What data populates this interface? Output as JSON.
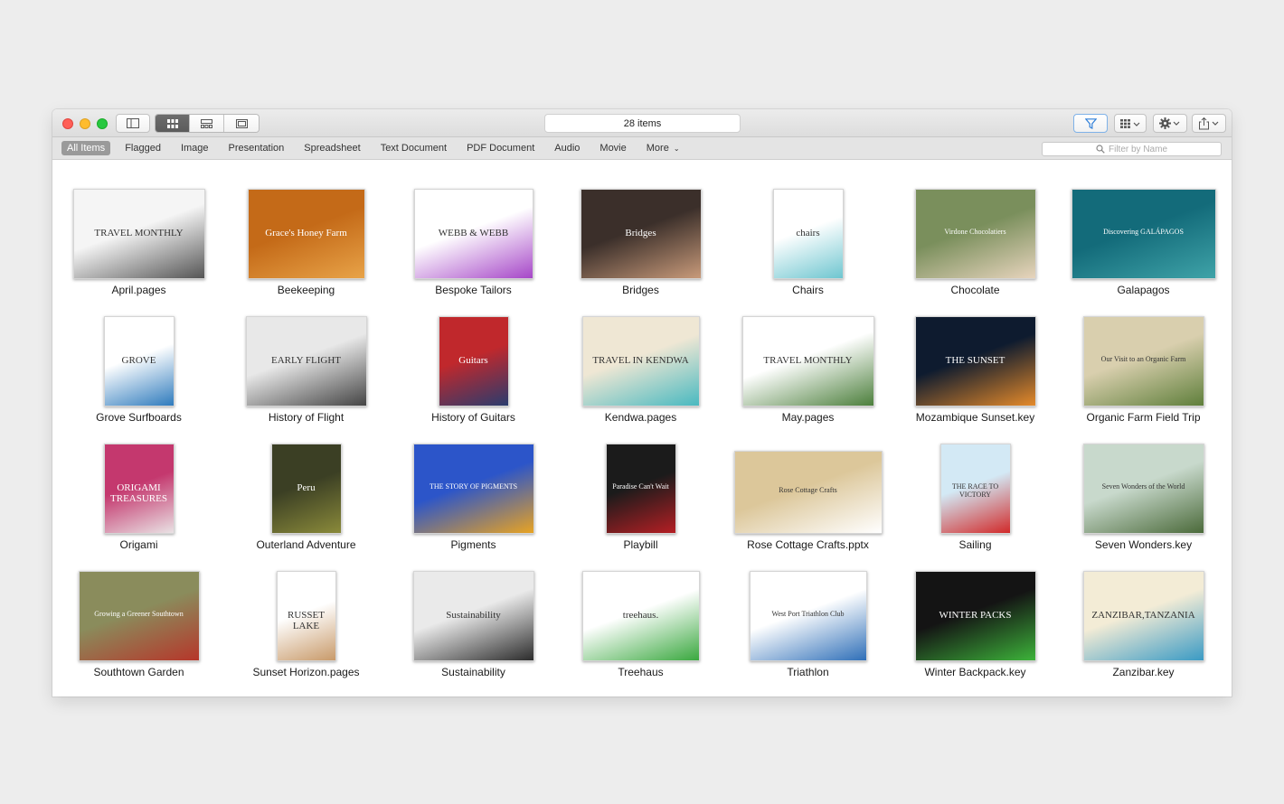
{
  "toolbar": {
    "item_count": "28 items",
    "search_placeholder": "Filter by Name"
  },
  "filters": [
    "All Items",
    "Flagged",
    "Image",
    "Presentation",
    "Spreadsheet",
    "Text Document",
    "PDF Document",
    "Audio",
    "Movie",
    "More"
  ],
  "active_filter": "All Items",
  "items": [
    {
      "name": "April.pages",
      "thumb_text": "TRAVEL MONTHLY",
      "colors": [
        "#f5f5f5",
        "#555555"
      ]
    },
    {
      "name": "Beekeeping",
      "thumb_text": "Grace's Honey Farm",
      "colors": [
        "#c46a18",
        "#e8a348"
      ]
    },
    {
      "name": "Bespoke Tailors",
      "thumb_text": "WEBB & WEBB",
      "colors": [
        "#ffffff",
        "#a647c8"
      ]
    },
    {
      "name": "Bridges",
      "thumb_text": "Bridges",
      "colors": [
        "#3b2f2a",
        "#c89a7a"
      ]
    },
    {
      "name": "Chairs",
      "thumb_text": "chairs",
      "colors": [
        "#ffffff",
        "#6fc6d0"
      ]
    },
    {
      "name": "Chocolate",
      "thumb_text": "Virdone Chocolatiers",
      "colors": [
        "#7a8f5c",
        "#e7d4bd"
      ]
    },
    {
      "name": "Galapagos",
      "thumb_text": "Discovering GALÁPAGOS",
      "colors": [
        "#136b7a",
        "#3fa3a8"
      ]
    },
    {
      "name": "Grove Surfboards",
      "thumb_text": "GROVE",
      "colors": [
        "#ffffff",
        "#2f7bbd"
      ]
    },
    {
      "name": "History of Flight",
      "thumb_text": "EARLY FLIGHT",
      "colors": [
        "#e8e8e8",
        "#444444"
      ]
    },
    {
      "name": "History of Guitars",
      "thumb_text": "Guitars",
      "colors": [
        "#c0282c",
        "#2a3c6e"
      ]
    },
    {
      "name": "Kendwa.pages",
      "thumb_text": "TRAVEL IN KENDWA",
      "colors": [
        "#efe7d4",
        "#49b9c0"
      ]
    },
    {
      "name": "May.pages",
      "thumb_text": "TRAVEL MONTHLY",
      "colors": [
        "#ffffff",
        "#4c7f3c"
      ]
    },
    {
      "name": "Mozambique Sunset.key",
      "thumb_text": "THE SUNSET",
      "colors": [
        "#0e1b2f",
        "#e58a2a"
      ]
    },
    {
      "name": "Organic Farm Field Trip",
      "thumb_text": "Our Visit to an Organic Farm",
      "colors": [
        "#d9cfae",
        "#5f7f3b"
      ]
    },
    {
      "name": "Origami",
      "thumb_text": "ORIGAMI TREASURES",
      "colors": [
        "#c4386e",
        "#e9e2e4"
      ]
    },
    {
      "name": "Outerland Adventure",
      "thumb_text": "Peru",
      "colors": [
        "#3b3f24",
        "#8a8a3a"
      ]
    },
    {
      "name": "Pigments",
      "thumb_text": "THE STORY OF PIGMENTS",
      "colors": [
        "#2c55c9",
        "#e8a323"
      ]
    },
    {
      "name": "Playbill",
      "thumb_text": "Paradise Can't Wait",
      "colors": [
        "#1b1b1b",
        "#b51f24"
      ]
    },
    {
      "name": "Rose Cottage Crafts.pptx",
      "thumb_text": "Rose Cottage Crafts",
      "colors": [
        "#dcc79a",
        "#ffffff"
      ]
    },
    {
      "name": "Sailing",
      "thumb_text": "THE RACE TO VICTORY",
      "colors": [
        "#d3e9f5",
        "#d12a2a"
      ]
    },
    {
      "name": "Seven Wonders.key",
      "thumb_text": "Seven Wonders of the World",
      "colors": [
        "#c8d9cc",
        "#4b6a3a"
      ]
    },
    {
      "name": "Southtown Garden",
      "thumb_text": "Growing a Greener Southtown",
      "colors": [
        "#8a8c5c",
        "#b6362a"
      ]
    },
    {
      "name": "Sunset Horizon.pages",
      "thumb_text": "RUSSET LAKE",
      "colors": [
        "#ffffff",
        "#c89a6a"
      ]
    },
    {
      "name": "Sustainability",
      "thumb_text": "Sustainability",
      "colors": [
        "#eaeaea",
        "#2c2c2c"
      ]
    },
    {
      "name": "Treehaus",
      "thumb_text": "treehaus.",
      "colors": [
        "#ffffff",
        "#3aa83f"
      ]
    },
    {
      "name": "Triathlon",
      "thumb_text": "West Port Triathlon Club",
      "colors": [
        "#ffffff",
        "#2f6fb8"
      ]
    },
    {
      "name": "Winter Backpack.key",
      "thumb_text": "WINTER PACKS",
      "colors": [
        "#141414",
        "#3db33a"
      ]
    },
    {
      "name": "Zanzibar.key",
      "thumb_text": "ZANZIBAR,TANZANIA",
      "colors": [
        "#f3ecd6",
        "#3a9ac4"
      ]
    }
  ]
}
